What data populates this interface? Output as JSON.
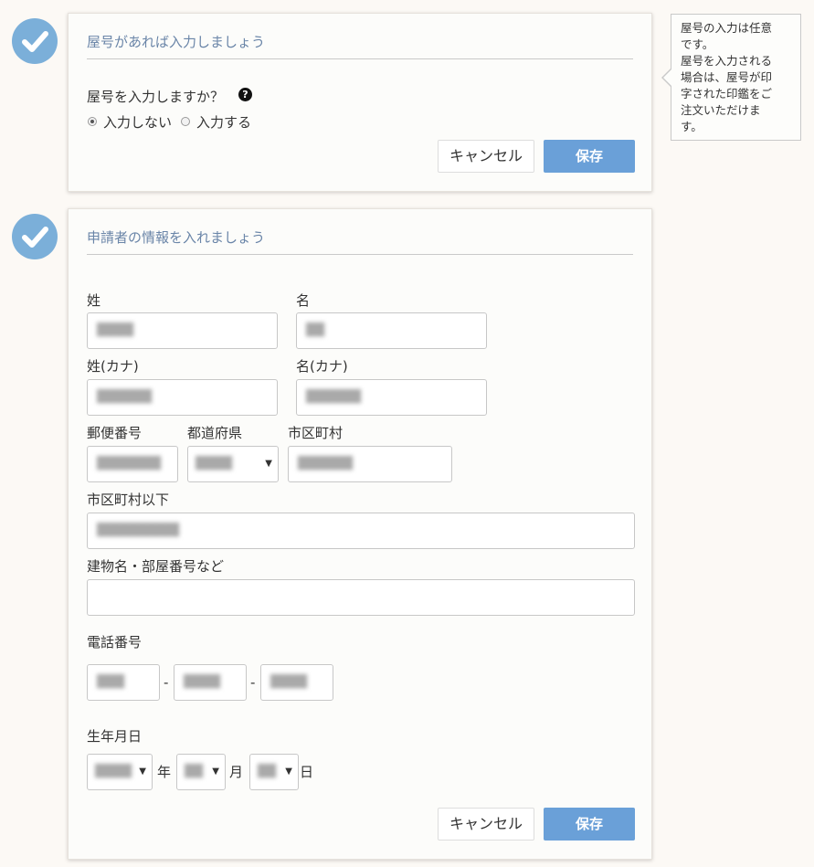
{
  "step1": {
    "title": "屋号があれば入力しましょう",
    "question": "屋号を入力しますか？",
    "help_icon": "?",
    "options": [
      "入力しない",
      "入力する"
    ],
    "selected": "入力しない",
    "cancel_label": "キャンセル",
    "save_label": "保存"
  },
  "tooltip": {
    "lines": [
      "屋号の入力は任意",
      "です。",
      "屋号を入力される",
      "場合は、屋号が印",
      "字された印鑑をご",
      "注文いただけま",
      "す。"
    ]
  },
  "step2": {
    "title": "申請者の情報を入れましょう",
    "labels": {
      "last_name": "姓",
      "first_name": "名",
      "last_name_kana": "姓(カナ)",
      "first_name_kana": "名(カナ)",
      "postal_code": "郵便番号",
      "prefecture": "都道府県",
      "city": "市区町村",
      "address": "市区町村以下",
      "building": "建物名・部屋番号など",
      "phone": "電話番号",
      "birthday": "生年月日"
    },
    "values": {
      "last_name": "████",
      "first_name": "██",
      "last_name_kana": "██████",
      "first_name_kana": "██████",
      "postal_code": "███████",
      "prefecture": "████",
      "city": "██████",
      "address": "█████████",
      "building": "",
      "phone_1": "███",
      "phone_2": "████",
      "phone_3": "████",
      "birth_year": "████",
      "birth_month": "██",
      "birth_day": "██"
    },
    "phone_separator": "-",
    "year_unit": "年",
    "month_unit": "月",
    "day_unit": "日",
    "cancel_label": "キャンセル",
    "save_label": "保存"
  },
  "colors": {
    "check": "#7bafd9",
    "save_button": "#6aa0d8",
    "title": "#6a85a8",
    "background": "#fcf9f5"
  },
  "icons": {
    "step_complete": "check-circle-icon",
    "help": "question-circle-icon",
    "select_arrow": "caret-down-icon"
  }
}
